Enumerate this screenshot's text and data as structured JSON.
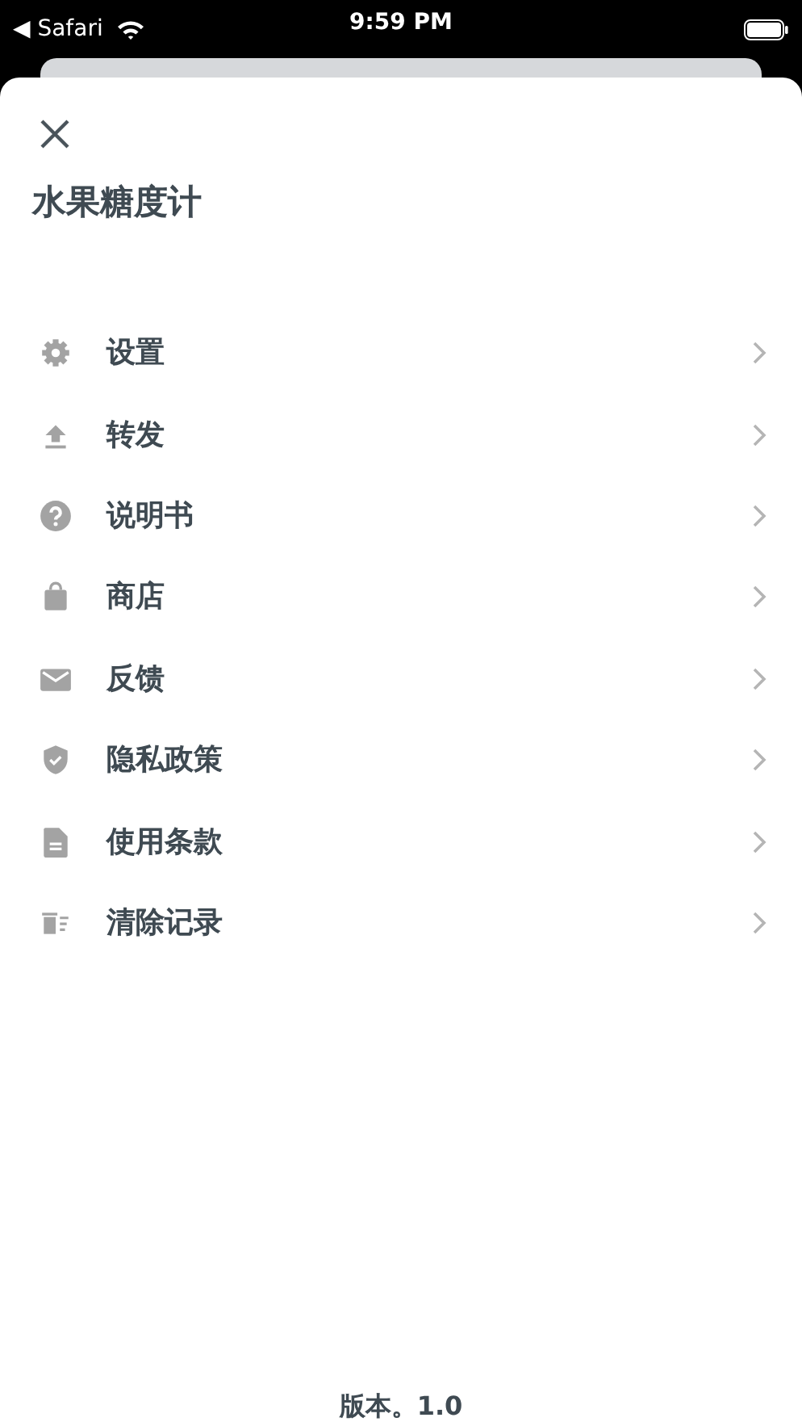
{
  "status_bar": {
    "back_label": "◀ Safari",
    "time": "9:59 PM"
  },
  "app_title": "水果糖度计",
  "menu_items": [
    {
      "kind": "settings",
      "label": "设置"
    },
    {
      "kind": "share",
      "label": "转发"
    },
    {
      "kind": "help",
      "label": "说明书"
    },
    {
      "kind": "store",
      "label": "商店"
    },
    {
      "kind": "mail",
      "label": "反馈"
    },
    {
      "kind": "privacy",
      "label": "隐私政策"
    },
    {
      "kind": "terms",
      "label": "使用条款"
    },
    {
      "kind": "clear",
      "label": "清除记录"
    }
  ],
  "version": "版本。1.0"
}
